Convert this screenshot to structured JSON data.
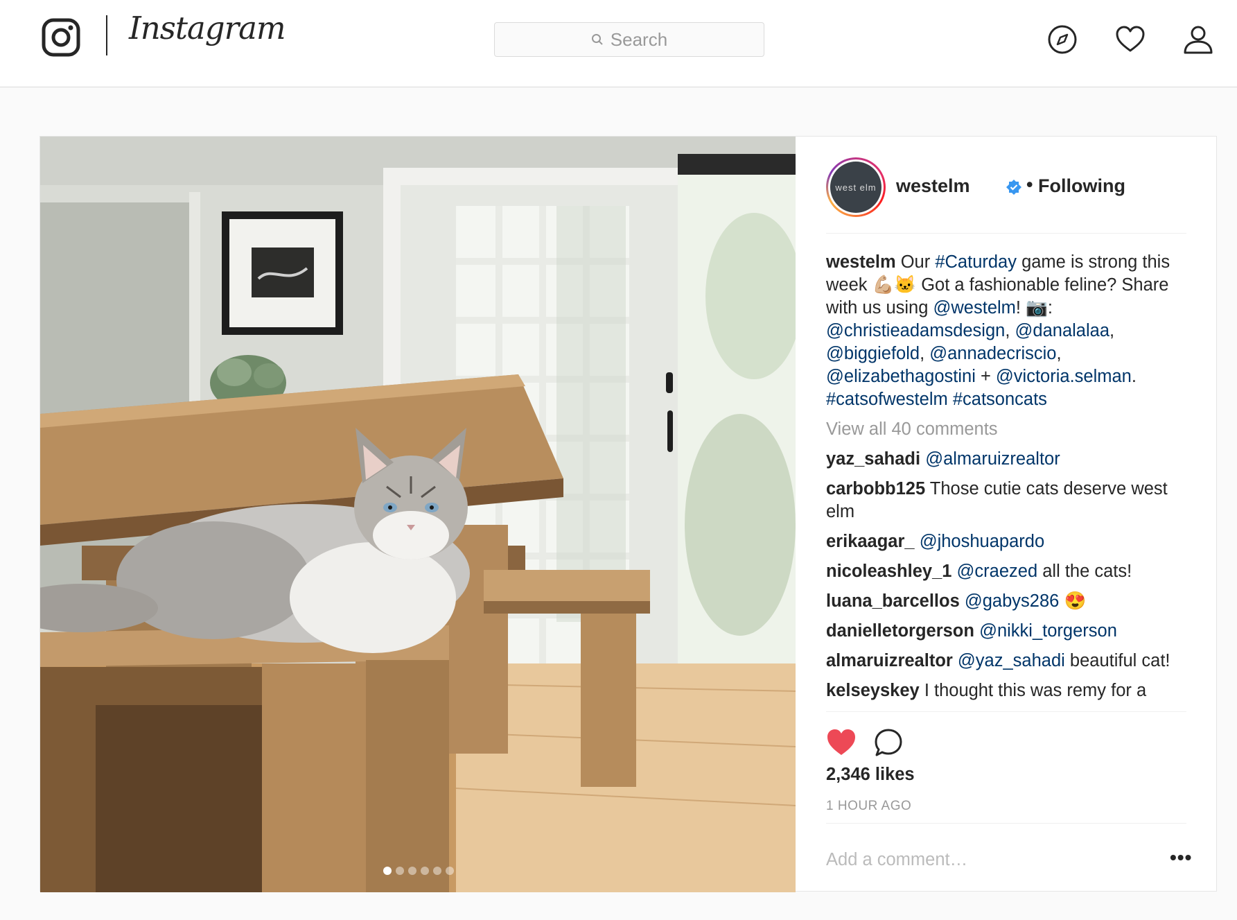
{
  "header": {
    "wordmark": "Instagram",
    "search_placeholder": "Search",
    "icons": [
      "instagram-glyph-icon",
      "search-icon",
      "compass-icon",
      "heart-icon",
      "profile-icon"
    ]
  },
  "post": {
    "username": "westelm",
    "avatar_text": "west elm",
    "follow_separator": "•",
    "follow_status": "Following",
    "caption": {
      "username": "westelm",
      "t1": " Our ",
      "h1": "#Caturday",
      "t2": " game is strong this week 💪🏼🐱 Got a fashionable feline? Share with us using ",
      "m1": "@westelm",
      "t3": "! 📷: ",
      "m2": "@christieadamsdesign",
      "s1": ", ",
      "m3": "@danalalaa",
      "s2": ", ",
      "m4": "@biggiefold",
      "s3": ", ",
      "m5": "@annadecriscio",
      "s4": ", ",
      "m6": "@elizabethagostini",
      "s5": " + ",
      "m7": "@victoria.selman",
      "s6": ". ",
      "h2": "#catsofwestelm",
      "s7": " ",
      "h3": "#catsoncats"
    },
    "view_all": "View all 40 comments",
    "comments": [
      {
        "user": "yaz_sahadi",
        "mention": "@almaruizrealtor",
        "text": ""
      },
      {
        "user": "carbobb125",
        "mention": "",
        "text": "Those cutie cats deserve west elm"
      },
      {
        "user": "erikaagar_",
        "mention": "@jhoshuapardo",
        "text": ""
      },
      {
        "user": "nicoleashley_1",
        "mention": "@craezed",
        "text": "all the cats!"
      },
      {
        "user": "luana_barcellos",
        "mention": "@gabys286",
        "text": "😍"
      },
      {
        "user": "danielletorgerson",
        "mention": "@nikki_torgerson",
        "text": ""
      },
      {
        "user": "almaruizrealtor",
        "mention": "@yaz_sahadi",
        "text": "beautiful cat!"
      },
      {
        "user": "kelseyskey",
        "mention": "",
        "text": "I thought this was remy for a"
      }
    ],
    "likes": "2,346 likes",
    "time": "1 HOUR AGO",
    "add_comment_placeholder": "Add a comment…",
    "more_label": "•••",
    "carousel": {
      "count": 6,
      "active": 0
    },
    "colors": {
      "like_red": "#ed4956",
      "link_blue": "#003569",
      "verified_blue": "#3897f0"
    }
  }
}
